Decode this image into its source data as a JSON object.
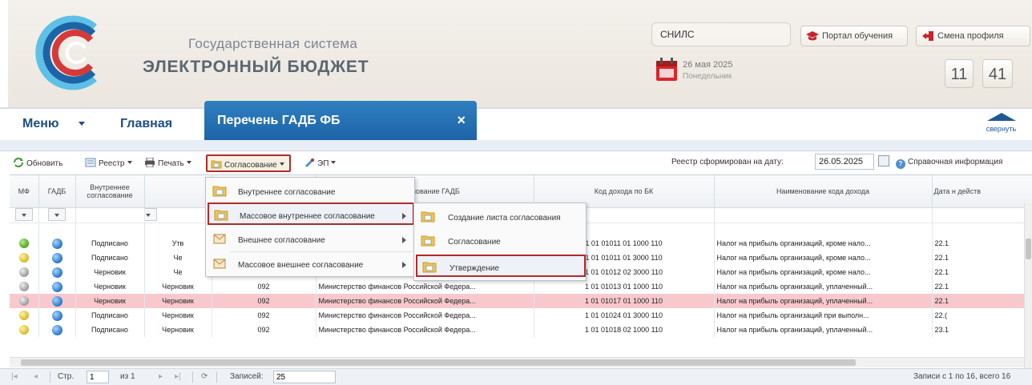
{
  "header": {
    "system_title": "Государственная система",
    "system_name": "ЭЛЕКТРОННЫЙ БЮДЖЕТ",
    "snils_label": "СНИЛС",
    "date_main": "26 мая 2025",
    "date_sub": "Понедельник",
    "portal_button": "Портал обучения",
    "profile_button": "Смена профиля",
    "clock_hours": "11",
    "clock_minutes": "41",
    "colors": {
      "brand_blue": "#1d64a7",
      "highlight_red": "#b22a2a"
    }
  },
  "nav": {
    "menu_label": "Меню",
    "home_label": "Главная",
    "active_tab": "Перечень ГАДБ ФБ",
    "tab_close": "×",
    "collapse_label": "свернуть"
  },
  "toolbar": {
    "refresh": "Обновить",
    "registry": "Реестр",
    "print": "Печать",
    "approval": "Согласование",
    "ep": "ЭП",
    "formed_on_label": "Реестр сформирован на дату:",
    "formed_on_date": "26.05.2025",
    "help": "Справочная информация"
  },
  "grid": {
    "columns": [
      "МФ",
      "ГАДБ",
      "Внутреннее согласование",
      "",
      "",
      "Наименование ГАДБ",
      "Код дохода по БК",
      "Наименование кода дохода",
      "Дата н действ"
    ],
    "rows": [
      {
        "mf": "green",
        "gadb": "globe",
        "inner": "Подписано",
        "c4": "Утв",
        "c5": "",
        "name": "",
        "code": "1 01 01011 01 1000 110",
        "code_name": "Налог на прибыль организаций, кроме нало...",
        "date": "22.1",
        "highlight": false
      },
      {
        "mf": "yellow",
        "gadb": "globe",
        "inner": "Подписано",
        "c4": "Че",
        "c5": "",
        "name": "",
        "code": "1 01 01011 01 3000 110",
        "code_name": "Налог на прибыль организаций, кроме нало...",
        "date": "22.1",
        "highlight": false
      },
      {
        "mf": "gray",
        "gadb": "globe",
        "inner": "Черновик",
        "c4": "Че",
        "c5": "",
        "name": "",
        "code": "1 01 01012 02 3000 110",
        "code_name": "Налог на прибыль организаций, кроме нало...",
        "date": "22.1",
        "highlight": false
      },
      {
        "mf": "gray",
        "gadb": "globe",
        "inner": "Черновик",
        "c4": "Черновик",
        "c5": "092",
        "name": "Министерство финансов Российской Федера...",
        "code": "1 01 01013 01 1000 110",
        "code_name": "Налог на прибыль организаций, уплаченный...",
        "date": "22.1",
        "highlight": false
      },
      {
        "mf": "gray",
        "gadb": "globe",
        "inner": "Черновик",
        "c4": "Черновик",
        "c5": "092",
        "name": "Министерство финансов Российской Федера...",
        "code": "1 01 01017 01 1000 110",
        "code_name": "Налог на прибыль организаций, уплаченный...",
        "date": "22.1",
        "highlight": true
      },
      {
        "mf": "yellow",
        "gadb": "globe",
        "inner": "Подписано",
        "c4": "Черновик",
        "c5": "092",
        "name": "Министерство финансов Российской Федера...",
        "code": "1 01 01024 01 3000 110",
        "code_name": "Налог на прибыль организаций при выполн...",
        "date": "22.(",
        "highlight": false
      },
      {
        "mf": "yellow",
        "gadb": "globe",
        "inner": "Подписано",
        "c4": "Черновик",
        "c5": "092",
        "name": "Министерство финансов Российской Федера...",
        "code": "1 01 01018 02 1000 110",
        "code_name": "Налог на прибыль организаций, уплаченный...",
        "date": "23.1",
        "highlight": false
      }
    ]
  },
  "pager": {
    "page_label": "Стр.",
    "page_value": "1",
    "of_label": "из 1",
    "records_label": "Записей:",
    "records_value": "25",
    "summary": "Записи с 1 по 16, всего 16"
  },
  "approval_menu": {
    "items": [
      "Внутреннее согласование",
      "Массовое внутреннее согласование",
      "Внешнее согласование",
      "Массовое внешнее согласование"
    ]
  },
  "mass_inner_submenu": {
    "items": [
      "Создание листа согласования",
      "Согласование",
      "Утверждение"
    ]
  }
}
